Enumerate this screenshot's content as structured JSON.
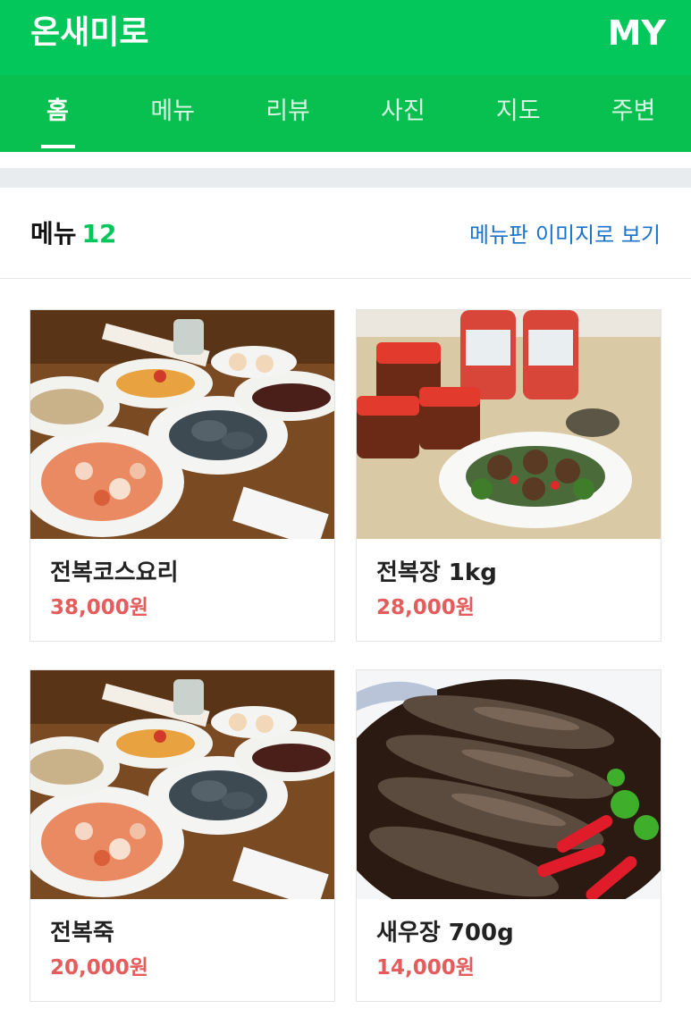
{
  "header": {
    "title": "온새미로",
    "my_label": "MY"
  },
  "tabs": [
    {
      "label": "홈",
      "active": true
    },
    {
      "label": "메뉴"
    },
    {
      "label": "리뷰"
    },
    {
      "label": "사진"
    },
    {
      "label": "지도"
    },
    {
      "label": "주변"
    }
  ],
  "menu_section": {
    "label": "메뉴",
    "count": "12",
    "board_link": "메뉴판 이미지로 보기"
  },
  "items": [
    {
      "name": "전복코스요리",
      "price": "38,000원",
      "image": "abalone-course-meal-photo"
    },
    {
      "name": "전복장 1kg",
      "price": "28,000원",
      "image": "soy-marinated-abalone-jars-photo"
    },
    {
      "name": "전복죽",
      "price": "20,000원",
      "image": "abalone-course-meal-photo"
    },
    {
      "name": "새우장 700g",
      "price": "14,000원",
      "image": "soy-marinated-shrimp-photo"
    }
  ],
  "colors": {
    "brand_green": "#03c75a",
    "price_red": "#e55c5c",
    "link_blue": "#1a73c8"
  }
}
